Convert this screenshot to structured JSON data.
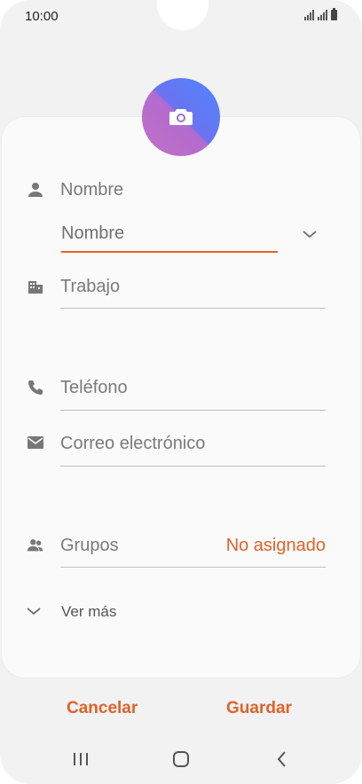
{
  "status": {
    "time": "10:00"
  },
  "form": {
    "name_section_label": "Nombre",
    "name_field_placeholder": "Nombre",
    "work_label": "Trabajo",
    "phone_label": "Teléfono",
    "email_label": "Correo electrónico",
    "groups_label": "Grupos",
    "groups_value": "No asignado",
    "more_label": "Ver más"
  },
  "actions": {
    "cancel": "Cancelar",
    "save": "Guardar"
  },
  "colors": {
    "accent": "#e0622b",
    "icon": "#777777"
  }
}
